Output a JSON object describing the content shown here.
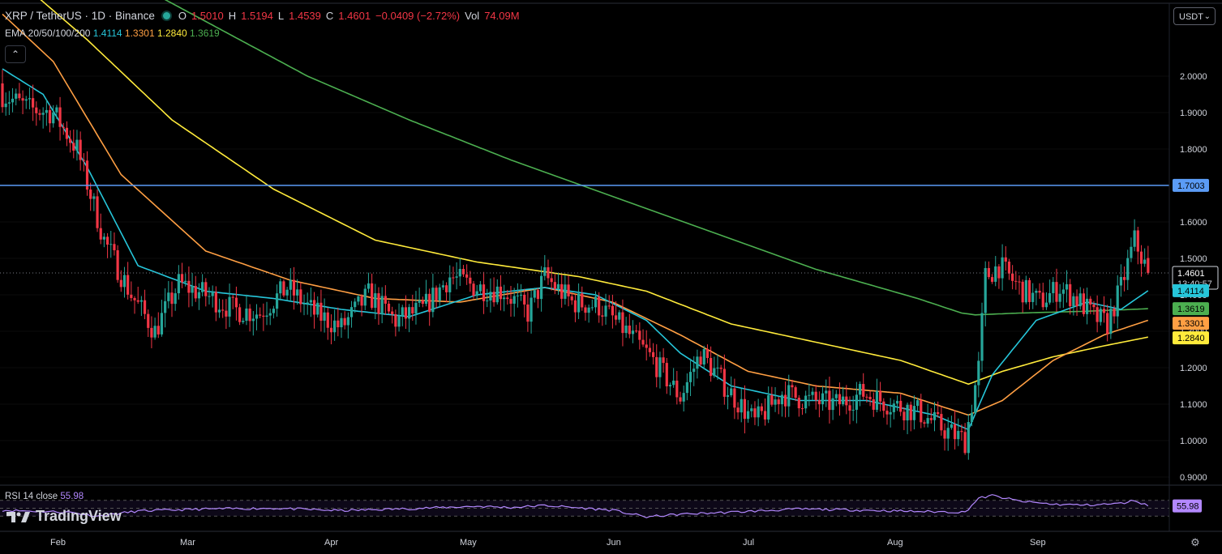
{
  "header": {
    "symbol": "XRP / TetherUS · 1D · Binance",
    "o_label": "O",
    "o_value": "1.5010",
    "h_label": "H",
    "h_value": "1.5194",
    "l_label": "L",
    "l_value": "1.4539",
    "c_label": "C",
    "c_value": "1.4601",
    "change": "−0.0409 (−2.72%)",
    "vol_label": "Vol",
    "vol_value": "74.09M"
  },
  "ema_legend": {
    "label": "EMA 20/50/100/200",
    "ema20": "1.4114",
    "ema50": "1.3301",
    "ema100": "1.2840",
    "ema200": "1.3619"
  },
  "currency_button": "USDT",
  "collapse_icon": "chevron-up-icon",
  "rsi": {
    "label": "RSI 14 close",
    "value": "55.98"
  },
  "branding": {
    "text": "TradingView",
    "icon": "tradingview-logo-icon"
  },
  "settings_icon": "gear-icon",
  "colors": {
    "up": "#26a69a",
    "down": "#f23645",
    "ema20": "#26c6da",
    "ema50": "#ff9f43",
    "ema100": "#ffeb3b",
    "ema200": "#4caf50",
    "rsi": "#b388ff",
    "hline": "#5b9cf6"
  },
  "chart_data": {
    "type": "candlestick",
    "title": "XRP / TetherUS · 1D · Binance",
    "ylim": [
      0.88,
      2.12
    ],
    "y_ticks": [
      "2.0000",
      "1.9000",
      "1.8000",
      "1.7000",
      "1.6000",
      "1.5000",
      "1.4000",
      "1.3000",
      "1.2000",
      "1.1000",
      "1.0000",
      "0.9000"
    ],
    "x_ticks": [
      "Feb",
      "Mar",
      "Apr",
      "May",
      "Jun",
      "Jul",
      "Aug",
      "Sep"
    ],
    "horizontal_line": {
      "value": 1.7003,
      "label": "1.7003"
    },
    "price_label": {
      "value": 1.4601,
      "label": "1.4601",
      "countdown": "13:40:57"
    },
    "ema_labels": [
      {
        "name": "EMA 20",
        "value": 1.4114,
        "label": "1.4114"
      },
      {
        "name": "EMA 200",
        "value": 1.3619,
        "label": "1.3619"
      },
      {
        "name": "EMA 50",
        "value": 1.3301,
        "label": "1.3301"
      },
      {
        "name": "EMA 100",
        "value": 1.284,
        "label": "1.2840"
      }
    ],
    "anchors": [
      [
        0,
        1.95
      ],
      [
        8,
        1.91
      ],
      [
        15,
        1.9
      ],
      [
        22,
        1.8
      ],
      [
        30,
        1.55
      ],
      [
        38,
        1.4
      ],
      [
        45,
        1.3
      ],
      [
        52,
        1.43
      ],
      [
        60,
        1.4
      ],
      [
        68,
        1.36
      ],
      [
        76,
        1.35
      ],
      [
        84,
        1.42
      ],
      [
        92,
        1.35
      ],
      [
        100,
        1.31
      ],
      [
        108,
        1.4
      ],
      [
        116,
        1.33
      ],
      [
        124,
        1.36
      ],
      [
        132,
        1.45
      ],
      [
        140,
        1.42
      ],
      [
        148,
        1.41
      ],
      [
        155,
        1.35
      ],
      [
        160,
        1.45
      ],
      [
        168,
        1.38
      ],
      [
        176,
        1.37
      ],
      [
        184,
        1.3
      ],
      [
        192,
        1.22
      ],
      [
        200,
        1.12
      ],
      [
        206,
        1.24
      ],
      [
        214,
        1.14
      ],
      [
        222,
        1.05
      ],
      [
        230,
        1.13
      ],
      [
        238,
        1.11
      ],
      [
        246,
        1.1
      ],
      [
        254,
        1.13
      ],
      [
        262,
        1.1
      ],
      [
        270,
        1.08
      ],
      [
        278,
        1.03
      ],
      [
        284,
        1.0
      ],
      [
        288,
        1.2
      ],
      [
        290,
        1.45
      ],
      [
        294,
        1.48
      ],
      [
        300,
        1.42
      ],
      [
        306,
        1.38
      ],
      [
        312,
        1.42
      ],
      [
        318,
        1.38
      ],
      [
        322,
        1.34
      ],
      [
        326,
        1.32
      ],
      [
        330,
        1.42
      ],
      [
        334,
        1.55
      ],
      [
        338,
        1.46
      ]
    ],
    "ema_anchors": {
      "ema20": [
        [
          0,
          2.02
        ],
        [
          12,
          1.95
        ],
        [
          25,
          1.75
        ],
        [
          40,
          1.48
        ],
        [
          60,
          1.41
        ],
        [
          80,
          1.39
        ],
        [
          100,
          1.36
        ],
        [
          120,
          1.34
        ],
        [
          140,
          1.4
        ],
        [
          160,
          1.42
        ],
        [
          175,
          1.4
        ],
        [
          190,
          1.33
        ],
        [
          200,
          1.24
        ],
        [
          215,
          1.15
        ],
        [
          235,
          1.11
        ],
        [
          255,
          1.11
        ],
        [
          275,
          1.07
        ],
        [
          285,
          1.03
        ],
        [
          292,
          1.18
        ],
        [
          305,
          1.33
        ],
        [
          320,
          1.38
        ],
        [
          330,
          1.36
        ],
        [
          338,
          1.4114
        ]
      ],
      "ema50": [
        [
          0,
          2.17
        ],
        [
          15,
          2.04
        ],
        [
          35,
          1.73
        ],
        [
          60,
          1.52
        ],
        [
          85,
          1.44
        ],
        [
          110,
          1.39
        ],
        [
          135,
          1.38
        ],
        [
          160,
          1.42
        ],
        [
          180,
          1.38
        ],
        [
          200,
          1.29
        ],
        [
          220,
          1.19
        ],
        [
          240,
          1.15
        ],
        [
          265,
          1.13
        ],
        [
          285,
          1.07
        ],
        [
          295,
          1.11
        ],
        [
          310,
          1.22
        ],
        [
          325,
          1.29
        ],
        [
          338,
          1.3301
        ]
      ],
      "ema100": [
        [
          0,
          2.3
        ],
        [
          25,
          2.1
        ],
        [
          50,
          1.88
        ],
        [
          80,
          1.69
        ],
        [
          110,
          1.55
        ],
        [
          140,
          1.49
        ],
        [
          170,
          1.45
        ],
        [
          190,
          1.41
        ],
        [
          215,
          1.32
        ],
        [
          240,
          1.27
        ],
        [
          265,
          1.22
        ],
        [
          285,
          1.155
        ],
        [
          295,
          1.19
        ],
        [
          310,
          1.23
        ],
        [
          325,
          1.26
        ],
        [
          338,
          1.284
        ]
      ],
      "ema200": [
        [
          0,
          2.42
        ],
        [
          30,
          2.3
        ],
        [
          60,
          2.15
        ],
        [
          90,
          2.0
        ],
        [
          120,
          1.88
        ],
        [
          150,
          1.77
        ],
        [
          180,
          1.67
        ],
        [
          210,
          1.57
        ],
        [
          240,
          1.47
        ],
        [
          270,
          1.39
        ],
        [
          283,
          1.35
        ],
        [
          287,
          1.345
        ],
        [
          300,
          1.35
        ],
        [
          320,
          1.355
        ],
        [
          338,
          1.3619
        ]
      ]
    },
    "rsi_series": {
      "name": "RSI 14 close",
      "range": [
        0,
        100
      ],
      "anchors": [
        [
          0,
          45
        ],
        [
          20,
          40
        ],
        [
          28,
          30
        ],
        [
          40,
          43
        ],
        [
          60,
          48
        ],
        [
          80,
          50
        ],
        [
          100,
          44
        ],
        [
          120,
          49
        ],
        [
          140,
          55
        ],
        [
          150,
          52
        ],
        [
          160,
          57
        ],
        [
          180,
          45
        ],
        [
          190,
          28
        ],
        [
          200,
          35
        ],
        [
          215,
          40
        ],
        [
          235,
          48
        ],
        [
          255,
          45
        ],
        [
          270,
          42
        ],
        [
          284,
          40
        ],
        [
          288,
          75
        ],
        [
          292,
          82
        ],
        [
          300,
          68
        ],
        [
          310,
          60
        ],
        [
          320,
          58
        ],
        [
          330,
          62
        ],
        [
          334,
          70
        ],
        [
          338,
          55.98
        ]
      ]
    }
  }
}
